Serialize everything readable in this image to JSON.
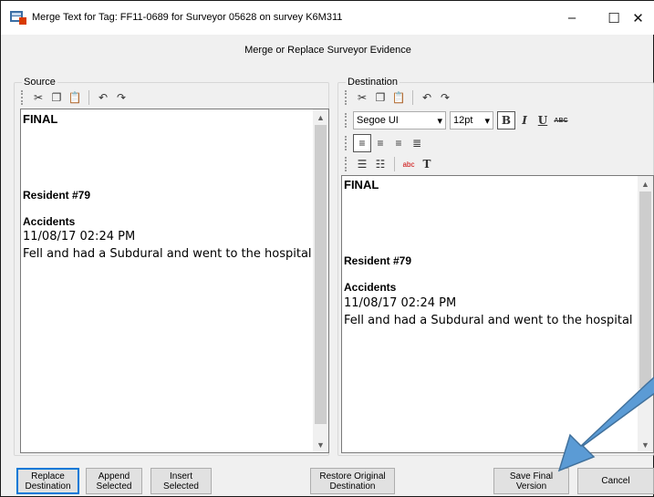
{
  "window": {
    "title": "Merge Text for Tag: FF11-0689 for Surveyor 05628 on survey K6M311",
    "minimize_glyph": "–",
    "maximize_glyph": "☐",
    "close_glyph": "✕"
  },
  "subtitle": "Merge or Replace Surveyor Evidence",
  "source": {
    "label": "Source",
    "content": {
      "heading": "FINAL",
      "resident": "Resident #79",
      "category": "Accidents",
      "timestamp": "11/08/17 02:24 PM",
      "text": "Fell and had a Subdural and went to the hospital"
    }
  },
  "destination": {
    "label": "Destination",
    "font": "Segoe UI",
    "size": "12pt",
    "format": {
      "bold": "B",
      "italic": "I",
      "underline": "U",
      "strike": "ABC"
    },
    "spell_icon": "abc",
    "text_icon": "T",
    "content": {
      "heading": "FINAL",
      "resident": "Resident #79",
      "category": "Accidents",
      "timestamp": "11/08/17 02:24 PM",
      "text": "Fell and had a Subdural and went to the hospital"
    }
  },
  "buttons": {
    "replace": [
      "Replace",
      "Destination"
    ],
    "append": [
      "Append",
      "Selected"
    ],
    "insert": [
      "Insert",
      "Selected"
    ],
    "restore": [
      "Restore Original",
      "Destination"
    ],
    "save": [
      "Save Final",
      "Version"
    ],
    "cancel": "Cancel"
  },
  "colors": {
    "accent": "#0078d7",
    "annotation_arrow": "#5b9bd5"
  }
}
